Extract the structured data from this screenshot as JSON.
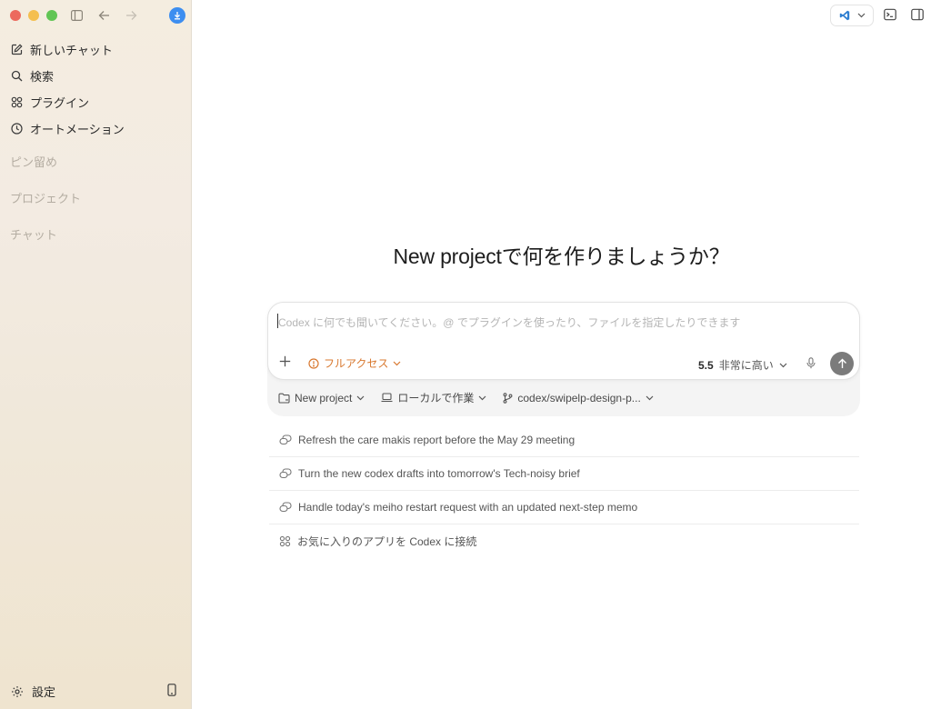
{
  "sidebar": {
    "nav": [
      {
        "label": "新しいチャット",
        "icon": "edit-icon"
      },
      {
        "label": "検索",
        "icon": "search-icon"
      },
      {
        "label": "プラグイン",
        "icon": "plugins-icon"
      },
      {
        "label": "オートメーション",
        "icon": "clock-icon"
      }
    ],
    "sections": {
      "pinned": "ピン留め",
      "projects": "プロジェクト",
      "chats": "チャット"
    },
    "settings_label": "設定"
  },
  "main": {
    "title": "New projectで何を作りましょうか？",
    "composer": {
      "placeholder": "Codex に何でも聞いてください。@ でプラグインを使ったり、ファイルを指定したりできます",
      "access_label": "フルアクセス",
      "model_version": "5.5",
      "model_level": "非常に高い"
    },
    "meta": {
      "project": "New project",
      "location": "ローカルで作業",
      "branch": "codex/swipelp-design-p..."
    },
    "suggestions": [
      {
        "text": "Refresh the care makis report before the May 29 meeting",
        "icon": "chat-bubbles-icon"
      },
      {
        "text": "Turn the new codex drafts into tomorrow's Tech-noisy brief",
        "icon": "chat-bubbles-icon"
      },
      {
        "text": "Handle today's meiho restart request with an updated next-step memo",
        "icon": "chat-bubbles-icon"
      },
      {
        "text": "お気に入りのアプリを Codex に接続",
        "icon": "plugins-icon"
      }
    ]
  },
  "colors": {
    "accent_orange": "#d8782f",
    "send_gray": "#7b7b7b",
    "download_blue": "#3d8ef0"
  }
}
